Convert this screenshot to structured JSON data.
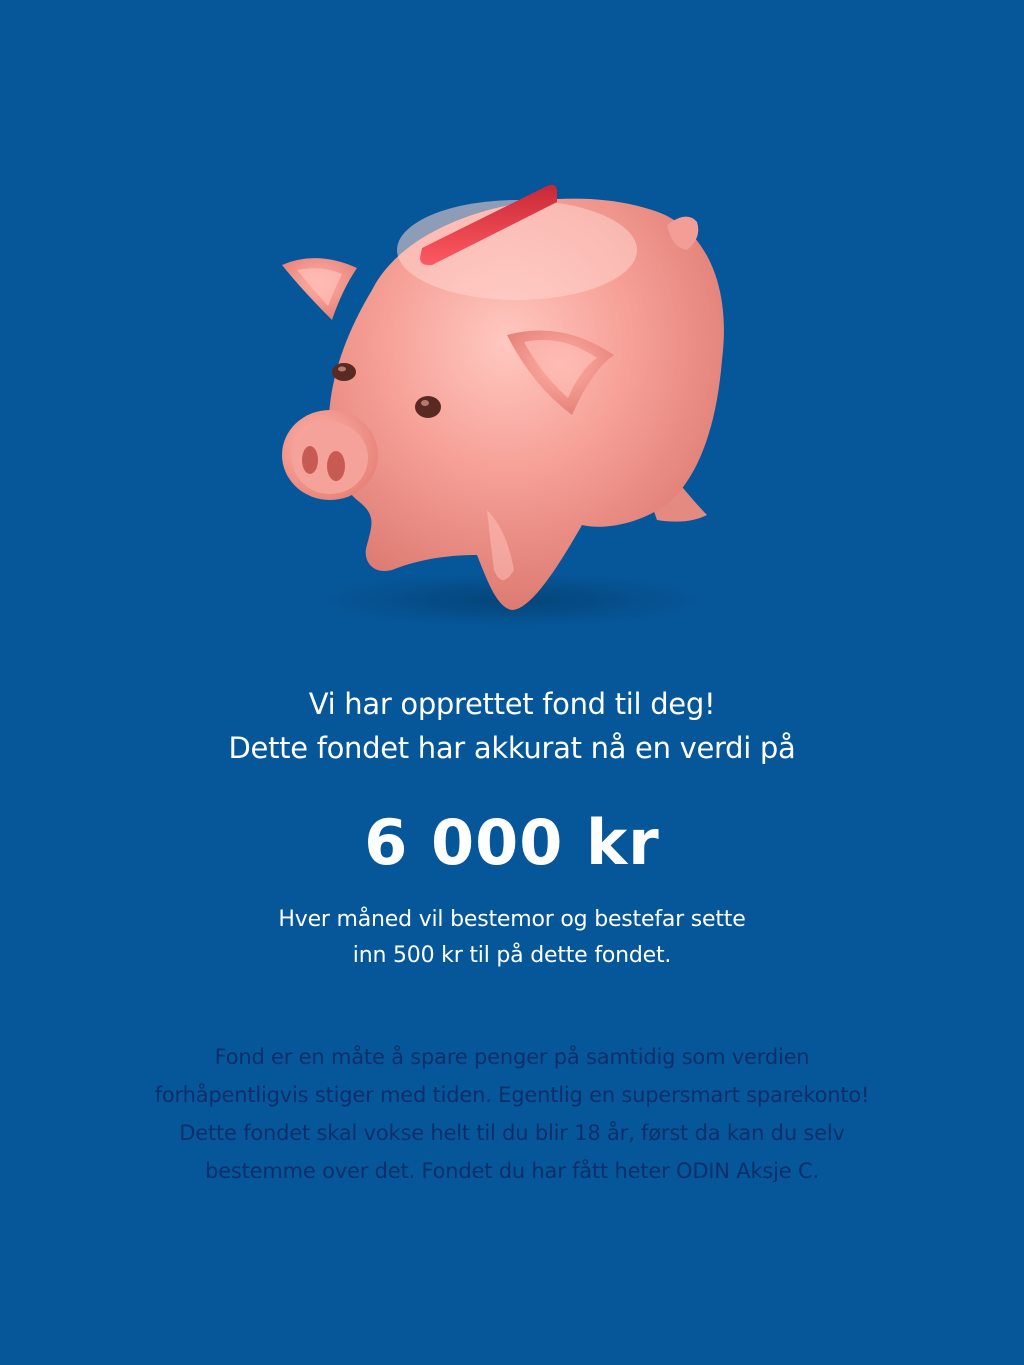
{
  "colors": {
    "background": "#06579a",
    "headline_text": "#ffffff",
    "body_text": "#0c2f6b",
    "pig_body": "#f49a93",
    "pig_slot": "#e63a4a"
  },
  "illustration": {
    "icon": "piggy-bank-icon"
  },
  "headline": {
    "line1": "Vi har opprettet fond til deg!",
    "line2": "Dette fondet har akkurat nå en verdi på"
  },
  "amount": {
    "value": "6 000 kr"
  },
  "monthly": {
    "line1": "Hver måned vil bestemor og bestefar sette",
    "line2": "inn 500 kr til på dette fondet."
  },
  "info": {
    "line1": "Fond er en måte å spare penger på samtidig som verdien",
    "line2": "forhåpentligvis stiger med tiden. Egentlig en supersmart sparekonto!",
    "line3": "Dette fondet skal vokse helt til du blir 18 år, først da kan du selv",
    "line4": "bestemme over det. Fondet du har fått heter ODIN Aksje C."
  }
}
